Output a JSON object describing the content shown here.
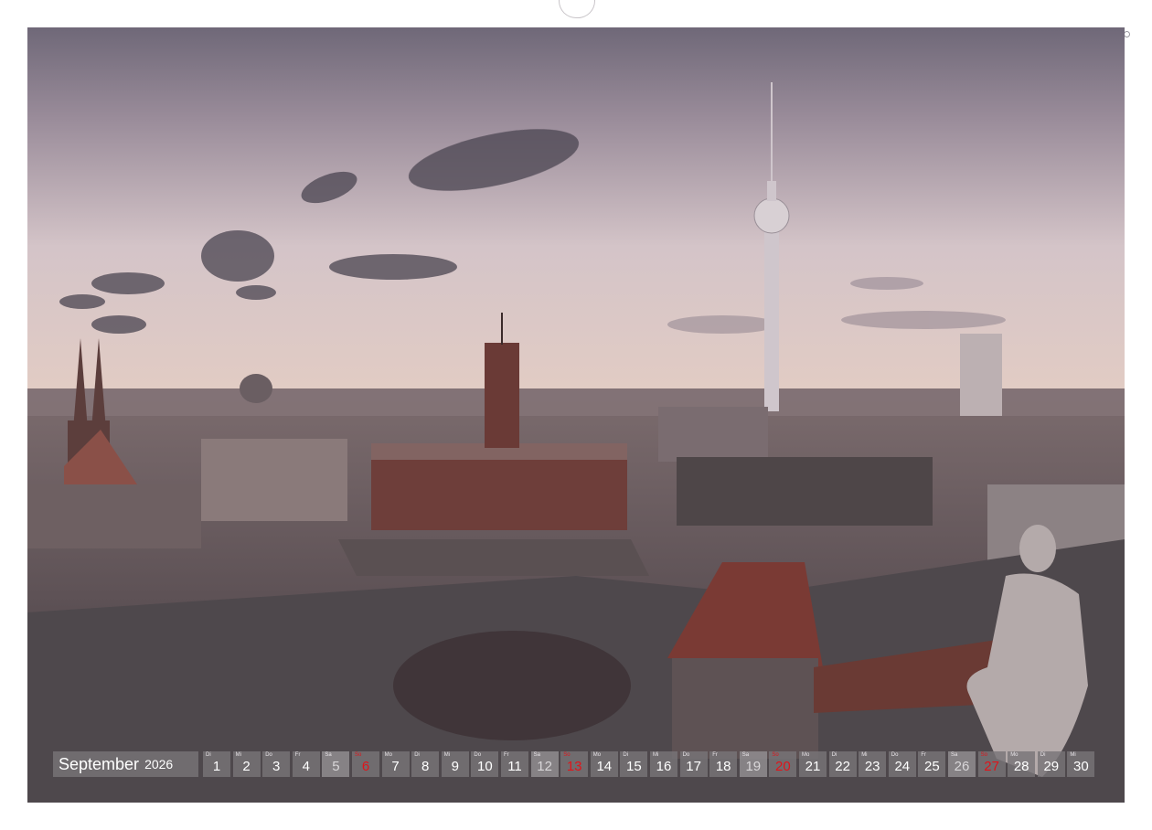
{
  "calendar": {
    "month": "September",
    "year": "2026",
    "days": [
      {
        "wd": "Di",
        "n": "1",
        "type": "week"
      },
      {
        "wd": "Mi",
        "n": "2",
        "type": "week"
      },
      {
        "wd": "Do",
        "n": "3",
        "type": "week"
      },
      {
        "wd": "Fr",
        "n": "4",
        "type": "week"
      },
      {
        "wd": "Sa",
        "n": "5",
        "type": "sat"
      },
      {
        "wd": "So",
        "n": "6",
        "type": "sun"
      },
      {
        "wd": "Mo",
        "n": "7",
        "type": "week"
      },
      {
        "wd": "Di",
        "n": "8",
        "type": "week"
      },
      {
        "wd": "Mi",
        "n": "9",
        "type": "week"
      },
      {
        "wd": "Do",
        "n": "10",
        "type": "week"
      },
      {
        "wd": "Fr",
        "n": "11",
        "type": "week"
      },
      {
        "wd": "Sa",
        "n": "12",
        "type": "sat"
      },
      {
        "wd": "So",
        "n": "13",
        "type": "sun"
      },
      {
        "wd": "Mo",
        "n": "14",
        "type": "week"
      },
      {
        "wd": "Di",
        "n": "15",
        "type": "week"
      },
      {
        "wd": "Mi",
        "n": "16",
        "type": "week"
      },
      {
        "wd": "Do",
        "n": "17",
        "type": "week"
      },
      {
        "wd": "Fr",
        "n": "18",
        "type": "week"
      },
      {
        "wd": "Sa",
        "n": "19",
        "type": "sat"
      },
      {
        "wd": "So",
        "n": "20",
        "type": "sun"
      },
      {
        "wd": "Mo",
        "n": "21",
        "type": "week"
      },
      {
        "wd": "Di",
        "n": "22",
        "type": "week"
      },
      {
        "wd": "Mi",
        "n": "23",
        "type": "week"
      },
      {
        "wd": "Do",
        "n": "24",
        "type": "week"
      },
      {
        "wd": "Fr",
        "n": "25",
        "type": "week"
      },
      {
        "wd": "Sa",
        "n": "26",
        "type": "sat"
      },
      {
        "wd": "So",
        "n": "27",
        "type": "sun"
      },
      {
        "wd": "Mo",
        "n": "28",
        "type": "week"
      },
      {
        "wd": "Di",
        "n": "29",
        "type": "week"
      },
      {
        "wd": "Mi",
        "n": "30",
        "type": "week"
      }
    ]
  },
  "colors": {
    "sunday": "#e0141a",
    "strip": "#787478"
  }
}
